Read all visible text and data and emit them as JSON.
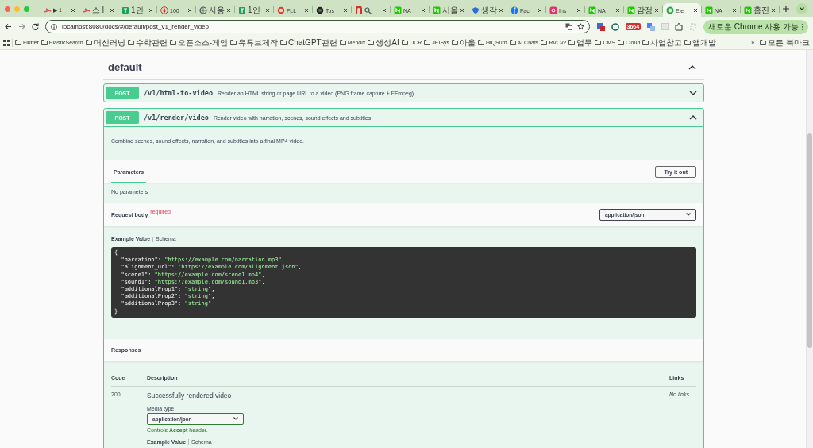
{
  "browser": {
    "tabs": [
      {
        "label": "▶ 1",
        "kind": "link",
        "selected": false
      },
      {
        "label": "스 l",
        "kind": "link",
        "selected": false
      },
      {
        "label": "1인",
        "kind": "sheet",
        "selected": false
      },
      {
        "label": "100",
        "kind": "flame",
        "selected": false
      },
      {
        "label": "사용",
        "kind": "globe",
        "selected": false
      },
      {
        "label": "1인",
        "kind": "sheet",
        "selected": false
      },
      {
        "label": "FLL",
        "kind": "ring",
        "selected": false
      },
      {
        "label": "Tos",
        "kind": "dark",
        "selected": false
      },
      {
        "kind": "magnet",
        "selected": false
      },
      {
        "label": "NA",
        "kind": "naver",
        "selected": false
      },
      {
        "label": "서울",
        "kind": "naver",
        "selected": false
      },
      {
        "label": "생각",
        "kind": "shield",
        "selected": false
      },
      {
        "label": "Fac",
        "kind": "facebook",
        "selected": false
      },
      {
        "label": "Ins",
        "kind": "instagram",
        "selected": false
      },
      {
        "label": "NA",
        "kind": "naver",
        "selected": false
      },
      {
        "label": "감정",
        "kind": "naver",
        "selected": false
      },
      {
        "label": "Ele",
        "kind": "round",
        "selected": true
      },
      {
        "label": "NA",
        "kind": "naver",
        "selected": false
      },
      {
        "label": "홈진",
        "kind": "naver",
        "selected": false
      }
    ],
    "address": "localhost:8080/docs/#/default/post_v1_render_video",
    "extension_badge": "3664",
    "update_button": "새로운 Chrome 사용 가능",
    "bookmarks": [
      "Flutter",
      "ElasticSearch",
      "머신러닝",
      "수학관련",
      "오픈소스-게임",
      "유튜브제작",
      "ChatGPT관련",
      "Mendix",
      "생성AI",
      "OCR",
      "JEISys",
      "아울",
      "HiQSum",
      "AI Chats",
      "RVCv2",
      "업무",
      "CMS",
      "Cloud",
      "사업참고",
      "앱개발"
    ],
    "more_bookmarks": "»",
    "all_bookmarks": "모든 북마크"
  },
  "section": {
    "title": "default",
    "expanded": true
  },
  "operations": [
    {
      "method": "POST",
      "path": "/v1/html-to-video",
      "summary": "Render an HTML string or page URL to a video (PNG frame capture + FFmpeg)",
      "expanded": false
    },
    {
      "method": "POST",
      "path": "/v1/render/video",
      "summary": "Render video with narration, scenes, sound effects and subtitles",
      "expanded": true,
      "description": "Combine scenes, sound effects, narration, and subtitles into a final MP4 video.",
      "parameters_tab": "Parameters",
      "try_button": "Try it out",
      "no_parameters": "No parameters",
      "request_body_label": "Request body",
      "required": "required",
      "content_type": "application/json",
      "example_tabs": [
        {
          "label": "Example Value",
          "selected": true
        },
        {
          "label": "Schema",
          "selected": false
        }
      ],
      "example_lines": [
        "{",
        "  \"narration\": \"https://example.com/narration.mp3\",",
        "  \"alignment_url\": \"https://example.com/alignment.json\",",
        "  \"scene1\": \"https://example.com/scene1.mp4\",",
        "  \"sound1\": \"https://example.com/sound1.mp3\",",
        "  \"additionalProp1\": \"string\",",
        "  \"additionalProp2\": \"string\",",
        "  \"additionalProp3\": \"string\"",
        "}"
      ],
      "responses_title": "Responses",
      "response_columns": [
        "Code",
        "Description",
        "Links"
      ],
      "responses": [
        {
          "code": "200",
          "description": "Successfully rendered video",
          "links": "No links",
          "media_type_label": "Media type",
          "media_type": "application/json",
          "controls_note": "Controls **Accept** header.",
          "example_tabs": [
            {
              "label": "Example Value",
              "selected": true
            },
            {
              "label": "Schema",
              "selected": false
            }
          ]
        }
      ]
    }
  ]
}
